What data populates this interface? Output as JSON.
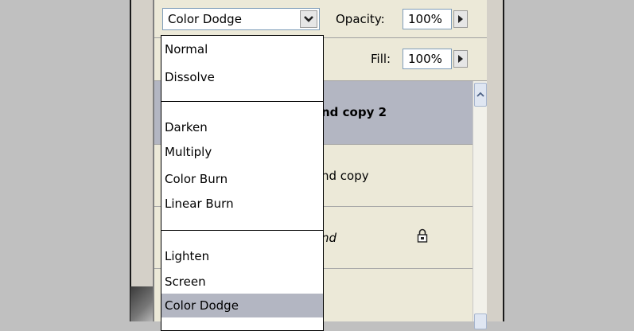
{
  "blend_mode": {
    "selected": "Color Dodge",
    "options": [
      {
        "label": "Normal",
        "group": 1
      },
      {
        "label": "Dissolve",
        "group": 1
      },
      {
        "label": "Darken",
        "group": 2
      },
      {
        "label": "Multiply",
        "group": 2
      },
      {
        "label": "Color Burn",
        "group": 2
      },
      {
        "label": "Linear Burn",
        "group": 2
      },
      {
        "label": "Lighten",
        "group": 3
      },
      {
        "label": "Screen",
        "group": 3
      },
      {
        "label": "Color Dodge",
        "group": 3
      }
    ]
  },
  "opacity": {
    "label": "Opacity:",
    "value": "100%"
  },
  "fill": {
    "label": "Fill:",
    "value": "100%"
  },
  "layers": [
    {
      "name_fragment": "nd copy 2",
      "selected": true
    },
    {
      "name_fragment": "nd copy",
      "selected": false
    },
    {
      "name_fragment": "nd",
      "selected": false,
      "locked": true,
      "italic": true
    },
    {
      "name_fragment": "",
      "selected": false
    }
  ],
  "icons": {
    "dropdown_arrow": "chevron-down-icon",
    "spinner_arrow": "triangle-right-icon",
    "lock": "lock-icon",
    "scroll_up": "scroll-up-arrow-icon"
  },
  "colors": {
    "panel_bg": "#ece9d8",
    "selected_layer": "#b3b6c2",
    "selected_option": "#b3b6c2"
  }
}
